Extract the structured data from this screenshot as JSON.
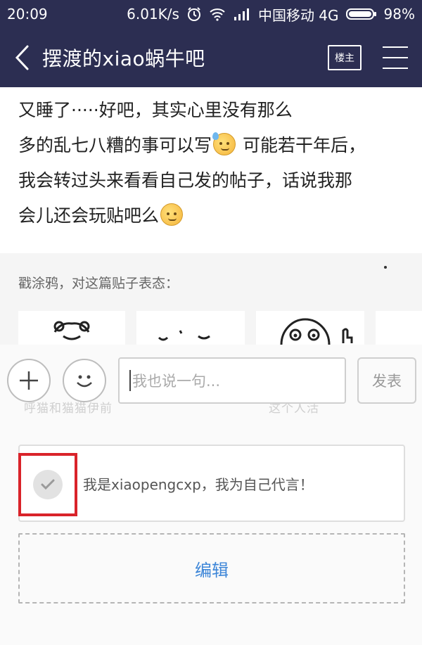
{
  "status": {
    "time": "20:09",
    "net_speed": "6.01K/s",
    "carrier": "中国移动 4G",
    "battery": "98%"
  },
  "nav": {
    "title": "摆渡的xiao蜗牛吧",
    "louzhu_label": "楼主"
  },
  "post": {
    "line1": "又睡了·····好吧，其实心里没有那么",
    "line2a": "多的乱七八糟的事可以写",
    "line2b": " 可能若干年后，",
    "line3": "我会转过头来看看自己发的帖子，话说我那",
    "line4": "会儿还会玩贴吧么"
  },
  "doodle": {
    "label": "戳涂鸦，对这篇贴子表态：",
    "ghost_left": "呼猫和猫猫伊前",
    "ghost_right": "这个人活"
  },
  "composer": {
    "placeholder": "我也说一句...",
    "send_label": "发表"
  },
  "self_statement": {
    "text": "我是xiaopengcxp，我为自己代言！"
  },
  "edit": {
    "label": "编辑"
  },
  "colors": {
    "nav_bg": "#2c2e52",
    "link_blue": "#3d86d8",
    "highlight_red": "#d9232a"
  }
}
